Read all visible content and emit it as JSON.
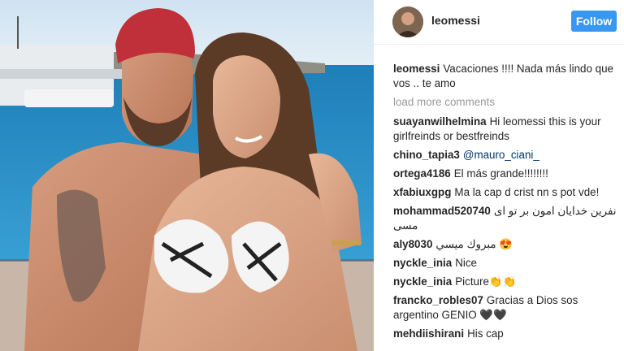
{
  "post": {
    "username": "leomessi",
    "follow_label": "Follow",
    "caption": {
      "user": "leomessi",
      "text": "Vacaciones !!!! Nada más lindo que vos .. te amo"
    },
    "load_more": "load more comments",
    "comments": [
      {
        "user": "suayanwilhelmina",
        "text": "Hi leomessi this is your girlfreinds or bestfreinds"
      },
      {
        "user": "chino_tapia3",
        "text": "@mauro_ciani_"
      },
      {
        "user": "ortega4186",
        "text": "El más grande!!!!!!!!"
      },
      {
        "user": "xfabiuxgpg",
        "text": "Ma la cap d crist nn s pot vde!"
      },
      {
        "user": "mohammad520740",
        "text": "نفرین خدایان امون بر تو ای مسی"
      },
      {
        "user": "aly8030",
        "text": "مبروك ميسي 😍"
      },
      {
        "user": "nyckle_inia",
        "text": "Nice"
      },
      {
        "user": "nyckle_inia",
        "text": "Picture👏👏"
      },
      {
        "user": "francko_robles07",
        "text": "Gracias a Dios sos argentino GENIO 🖤🖤"
      },
      {
        "user": "mehdiishirani",
        "text": "His cap"
      }
    ]
  },
  "colors": {
    "accent": "#3897f0",
    "text": "#262626",
    "muted": "#999999"
  }
}
